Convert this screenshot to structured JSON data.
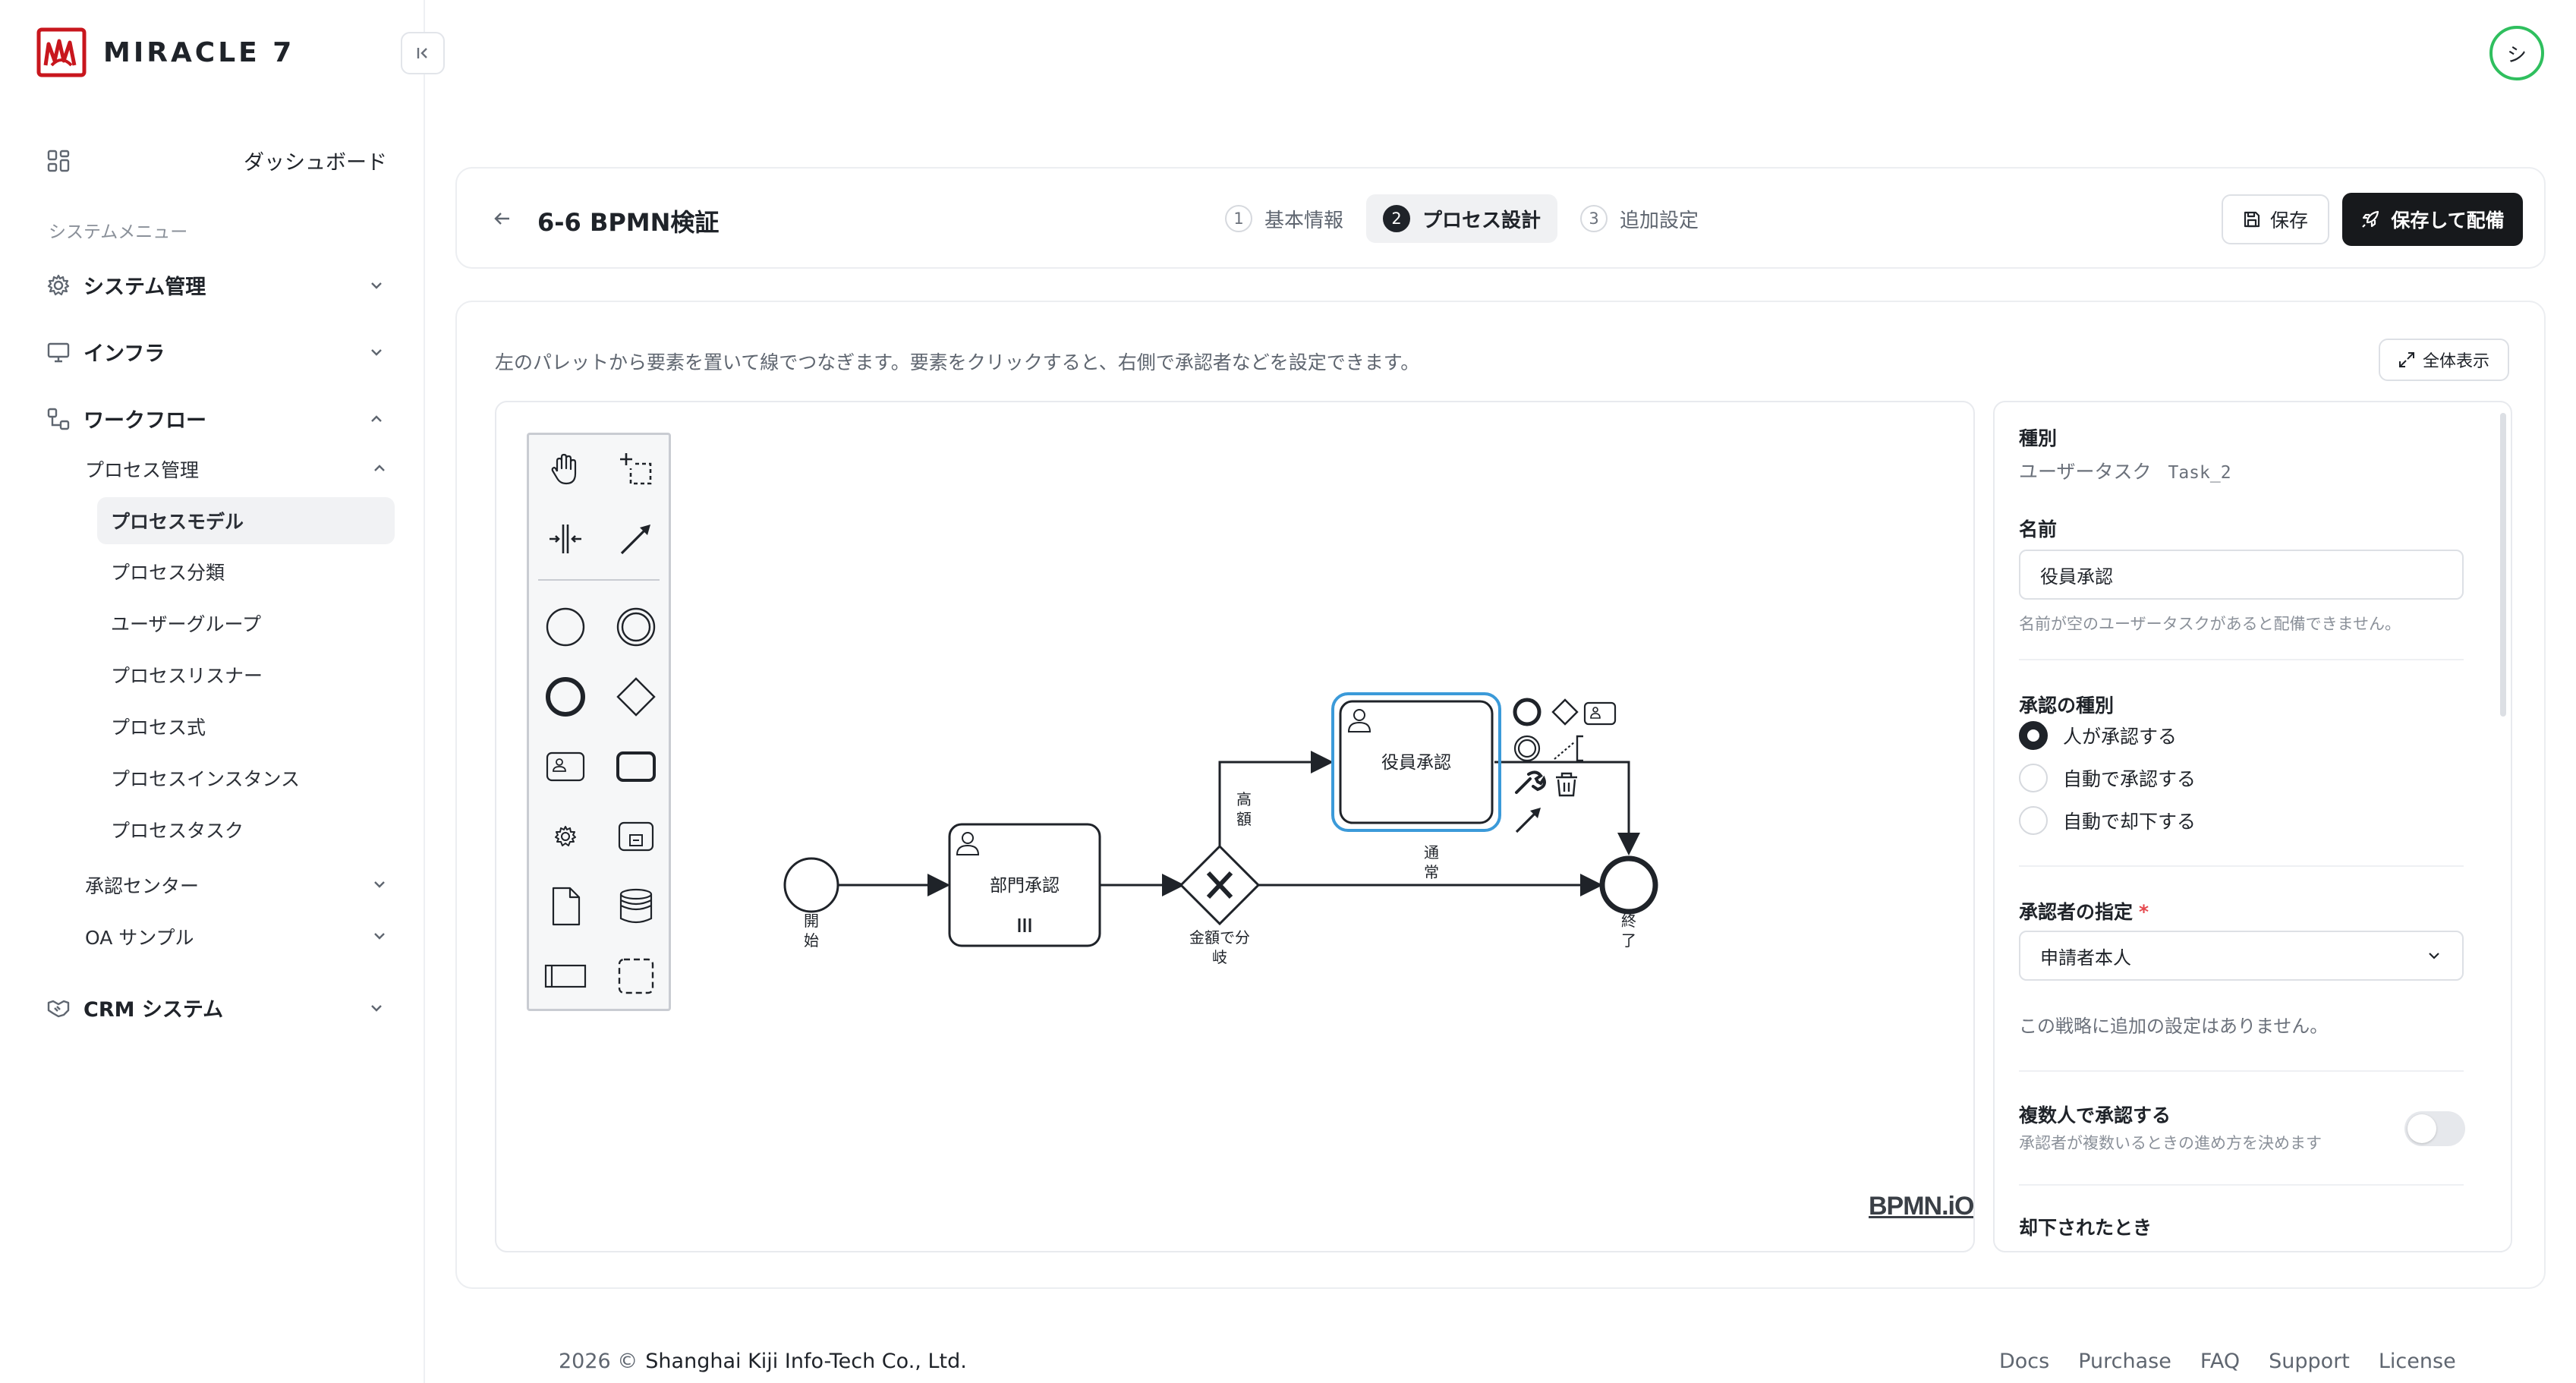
{
  "brand": {
    "name": "MIRACLE 7",
    "color": "#c8161d"
  },
  "avatar": {
    "initial": "シ",
    "ring_color": "#2fbf5e"
  },
  "sidebar": {
    "dashboard": "ダッシュボード",
    "section_label": "システムメニュー",
    "groups": [
      {
        "label": "システム管理",
        "icon": "gear-icon",
        "expanded": false
      },
      {
        "label": "インフラ",
        "icon": "monitor-icon",
        "expanded": false
      },
      {
        "label": "ワークフロー",
        "icon": "workflow-icon",
        "expanded": true
      },
      {
        "label": "CRM システム",
        "icon": "handshake-icon",
        "expanded": false
      }
    ],
    "workflow_sub": {
      "process_mgmt": "プロセス管理",
      "items": [
        "プロセスモデル",
        "プロセス分類",
        "ユーザーグループ",
        "プロセスリスナー",
        "プロセス式",
        "プロセスインスタンス",
        "プロセスタスク"
      ],
      "active_item": "プロセスモデル",
      "approval_center": "承認センター",
      "oa_sample": "OA サンプル"
    }
  },
  "header": {
    "title": "6-6 BPMN検証",
    "steps": [
      {
        "num": "1",
        "label": "基本情報",
        "active": false
      },
      {
        "num": "2",
        "label": "プロセス設計",
        "active": true
      },
      {
        "num": "3",
        "label": "追加設定",
        "active": false
      }
    ],
    "save_label": "保存",
    "deploy_label": "保存して配備"
  },
  "editor": {
    "hint": "左のパレットから要素を置いて線でつなぎます。要素をクリックすると、右側で承認者などを設定できます。",
    "fullscreen_label": "全体表示",
    "watermark": "BPMN.iO",
    "diagram": {
      "start_label_1": "開",
      "start_label_2": "始",
      "task1_label": "部門承認",
      "gateway_label_1": "金額で分",
      "gateway_label_2": "岐",
      "flow_high_1": "高",
      "flow_high_2": "額",
      "flow_normal_1": "通",
      "flow_normal_2": "常",
      "task2_label": "役員承認",
      "end_label_1": "終",
      "end_label_2": "了",
      "selection_color": "#3b9ad9"
    }
  },
  "props": {
    "type_heading": "種別",
    "type_value": "ユーザータスク",
    "type_id": "Task_2",
    "name_heading": "名前",
    "name_value": "役員承認",
    "name_help": "名前が空のユーザータスクがあると配備できません。",
    "approval_type_heading": "承認の種別",
    "approval_options": [
      {
        "label": "人が承認する",
        "selected": true
      },
      {
        "label": "自動で承認する",
        "selected": false
      },
      {
        "label": "自動で却下する",
        "selected": false
      }
    ],
    "approver_heading": "承認者の指定",
    "required_mark": "*",
    "approver_value": "申請者本人",
    "approver_note": "この戦略に追加の設定はありません。",
    "multi_heading": "複数人で承認する",
    "multi_help": "承認者が複数いるときの進め方を決めます",
    "multi_enabled": false,
    "rejected_heading": "却下されたとき"
  },
  "footer": {
    "year": "2026 ©",
    "company": "Shanghai Kiji Info-Tech Co., Ltd.",
    "links": [
      "Docs",
      "Purchase",
      "FAQ",
      "Support",
      "License"
    ]
  }
}
